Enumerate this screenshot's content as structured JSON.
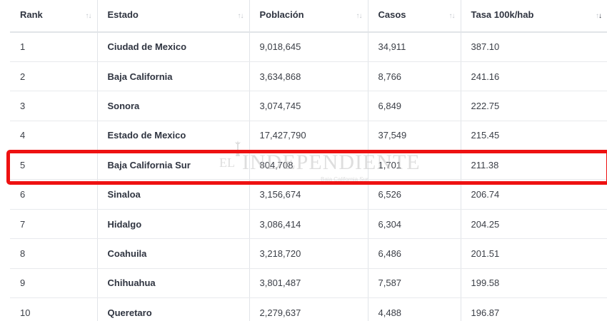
{
  "table": {
    "columns": [
      "Rank",
      "Estado",
      "Población",
      "Casos",
      "Tasa 100k/hab"
    ],
    "sort": {
      "column": "Tasa 100k/hab",
      "direction": "descending"
    },
    "rows": [
      [
        "1",
        "Ciudad de Mexico",
        "9,018,645",
        "34,911",
        "387.10"
      ],
      [
        "2",
        "Baja California",
        "3,634,868",
        "8,766",
        "241.16"
      ],
      [
        "3",
        "Sonora",
        "3,074,745",
        "6,849",
        "222.75"
      ],
      [
        "4",
        "Estado de Mexico",
        "17,427,790",
        "37,549",
        "215.45"
      ],
      [
        "5",
        "Baja California Sur",
        "804,708",
        "1,701",
        "211.38"
      ],
      [
        "6",
        "Sinaloa",
        "3,156,674",
        "6,526",
        "206.74"
      ],
      [
        "7",
        "Hidalgo",
        "3,086,414",
        "6,304",
        "204.25"
      ],
      [
        "8",
        "Coahuila",
        "3,218,720",
        "6,486",
        "201.51"
      ],
      [
        "9",
        "Chihuahua",
        "3,801,487",
        "7,587",
        "199.58"
      ],
      [
        "10",
        "Queretaro",
        "2,279,637",
        "4,488",
        "196.87"
      ]
    ]
  },
  "highlight": {
    "row_rank": "5",
    "color": "#ee1111"
  },
  "watermark": {
    "prefix": "EL",
    "name": "INDEPENDIENTE",
    "subtitle": "Baja California Sur"
  },
  "icons": {
    "sort": "sort-arrows-icon",
    "watermark_logo": "angel-statue-logo"
  }
}
